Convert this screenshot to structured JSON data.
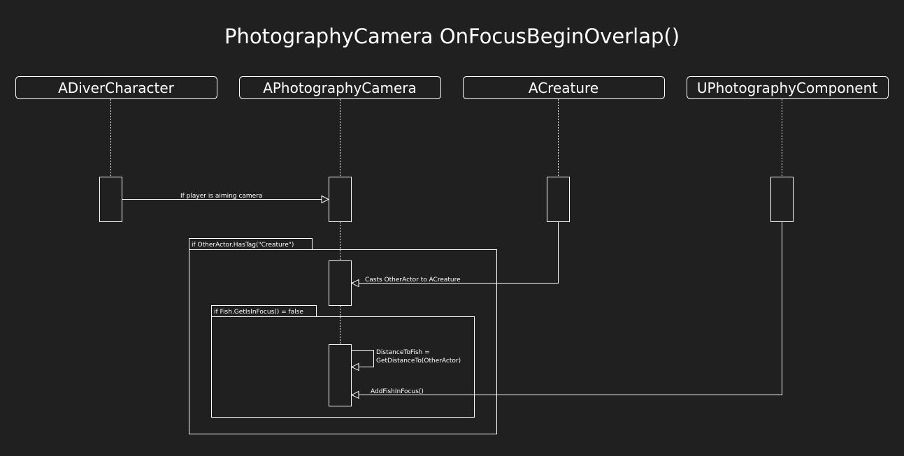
{
  "title": "PhotographyCamera OnFocusBeginOverlap()",
  "participants": [
    {
      "label": "ADiverCharacter"
    },
    {
      "label": "APhotographyCamera"
    },
    {
      "label": "ACreature"
    },
    {
      "label": "UPhotographyComponent"
    }
  ],
  "fragments": [
    {
      "label": "if OtherActor.HasTag(\"Creature\")"
    },
    {
      "label": "if Fish.GetIsInFocus() = false"
    }
  ],
  "messages": [
    {
      "label": "If player is aiming camera"
    },
    {
      "label": "Casts OtherActor to ACreature"
    },
    {
      "label_line1": "DistanceToFish =",
      "label_line2": "GetDistanceTo(OtherActor)"
    },
    {
      "label": "AddFishInFocus()"
    }
  ],
  "colors": {
    "background": "#202020",
    "stroke": "#ffffff",
    "text": "#ffffff"
  }
}
